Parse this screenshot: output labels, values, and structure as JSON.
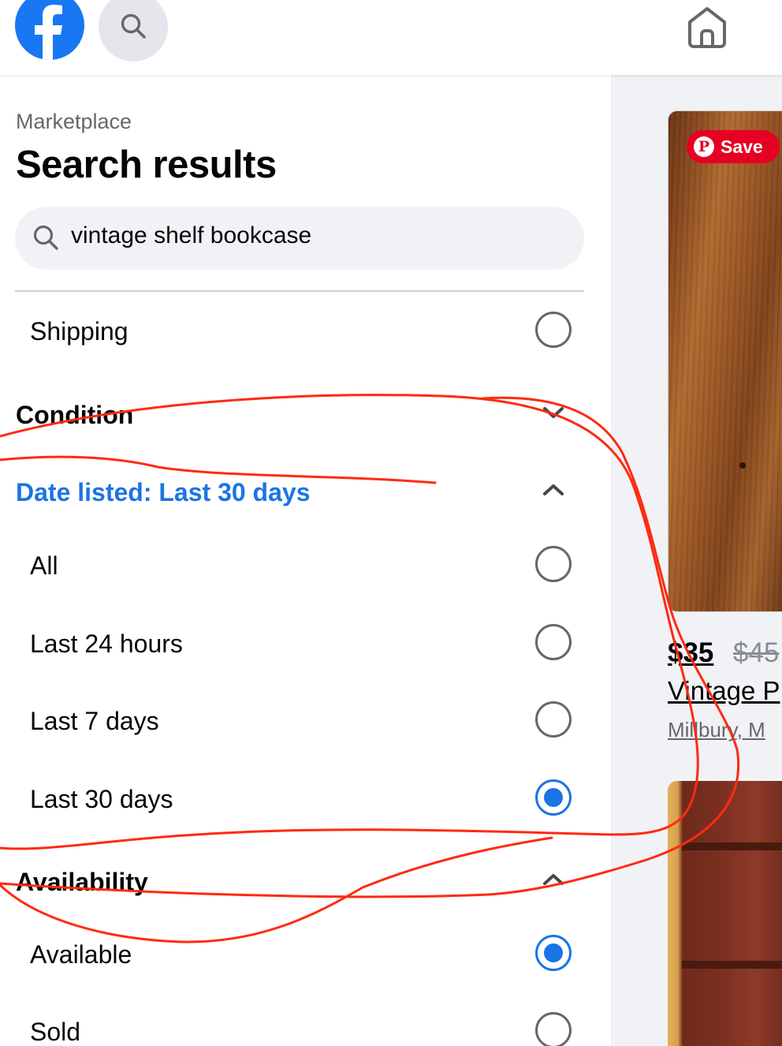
{
  "header": {
    "logo_icon": "facebook-logo-icon",
    "search_icon": "search-icon",
    "home_icon": "home-icon"
  },
  "sidebar": {
    "breadcrumb": "Marketplace",
    "title": "Search results",
    "search": {
      "value": "vintage shelf bookcase"
    },
    "shipping": {
      "label": "Shipping",
      "selected": false
    },
    "condition": {
      "label": "Condition",
      "expanded": false
    },
    "date_listed": {
      "label": "Date listed: Last 30 days",
      "expanded": true,
      "options": [
        {
          "label": "All",
          "selected": false
        },
        {
          "label": "Last 24 hours",
          "selected": false
        },
        {
          "label": "Last 7 days",
          "selected": false
        },
        {
          "label": "Last 30 days",
          "selected": true
        }
      ]
    },
    "availability": {
      "label": "Availability",
      "expanded": true,
      "options": [
        {
          "label": "Available",
          "selected": true
        },
        {
          "label": "Sold",
          "selected": false
        }
      ]
    }
  },
  "listing": {
    "save_label": "Save",
    "price": "$35",
    "original_price": "$45",
    "title": "Vintage P",
    "location": "Millbury, M"
  },
  "colors": {
    "accent": "#1b74e4",
    "brand": "#1877f2",
    "pinterest": "#e60023",
    "annotation": "#ff2a10"
  }
}
